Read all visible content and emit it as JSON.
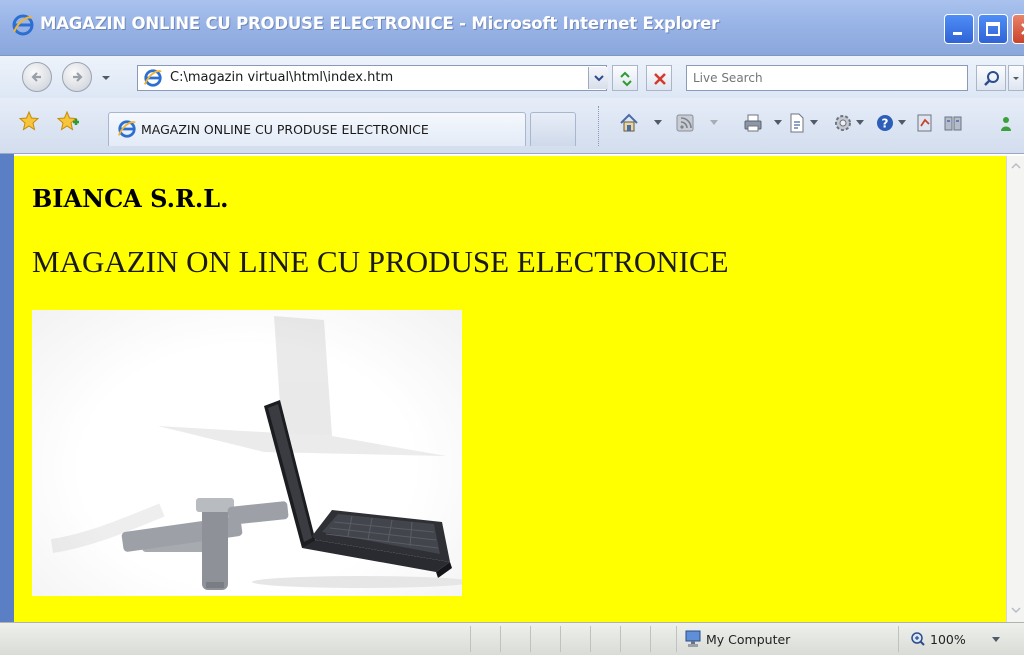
{
  "window": {
    "title": "MAGAZIN ONLINE CU PRODUSE ELECTRONICE - Microsoft Internet Explorer"
  },
  "address_bar": {
    "url": "C:\\magazin virtual\\html\\index.htm"
  },
  "search": {
    "placeholder": "Live Search"
  },
  "tabs": [
    {
      "label": "MAGAZIN ONLINE CU PRODUSE ELECTRONICE",
      "active": true
    }
  ],
  "page": {
    "company": "BIANCA S.R.L.",
    "heading": "MAGAZIN ON LINE CU PRODUSE ELECTRONICE",
    "background_color": "#ffff00",
    "image": "laptop-on-arm-stand"
  },
  "status_bar": {
    "zone": "My Computer",
    "zoom": "100%"
  },
  "icons": [
    "ie-logo",
    "back-arrow",
    "forward-arrow",
    "refresh",
    "stop",
    "search",
    "favorites-star",
    "add-favorites",
    "home",
    "feeds",
    "print",
    "page",
    "tools",
    "help",
    "research",
    "messenger",
    "computer",
    "zoom"
  ]
}
